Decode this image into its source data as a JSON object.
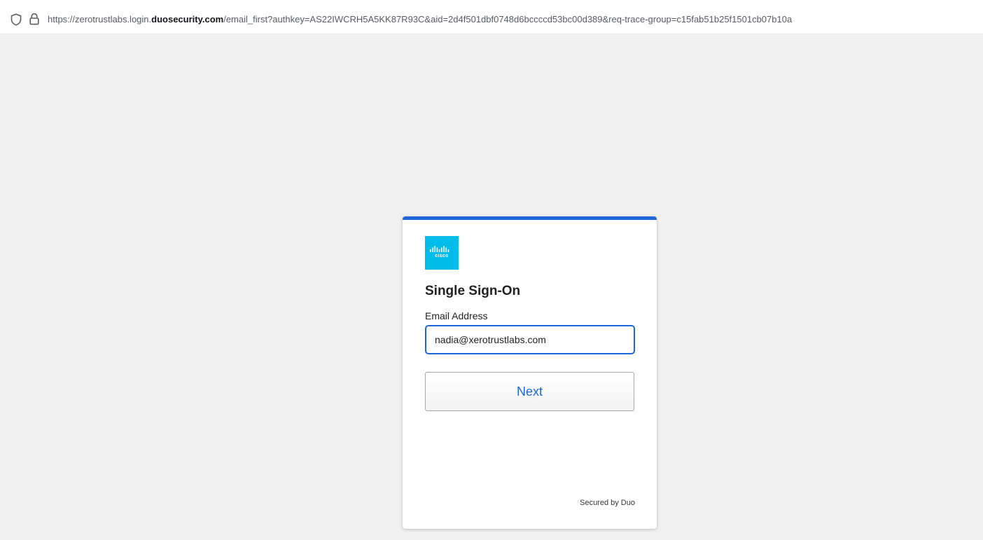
{
  "browser": {
    "url_prefix": "https://zerotrustlabs.login.",
    "url_domain": "duosecurity.com",
    "url_suffix": "/email_first?authkey=AS22IWCRH5A5KK87R93C&aid=2d4f501dbf0748d6bccccd53bc00d389&req-trace-group=c15fab51b25f1501cb07b10a",
    "icons": [
      "shield-icon",
      "lock-icon"
    ]
  },
  "login": {
    "logo_text": "cisco",
    "title": "Single Sign-On",
    "email_label": "Email Address",
    "email_value": "nadia@xerotrustlabs.com",
    "next_label": "Next",
    "footer": "Secured by Duo"
  },
  "colors": {
    "accent": "#1f66d9",
    "logo_bg": "#00bceb",
    "page_bg": "#f0f0f0"
  }
}
